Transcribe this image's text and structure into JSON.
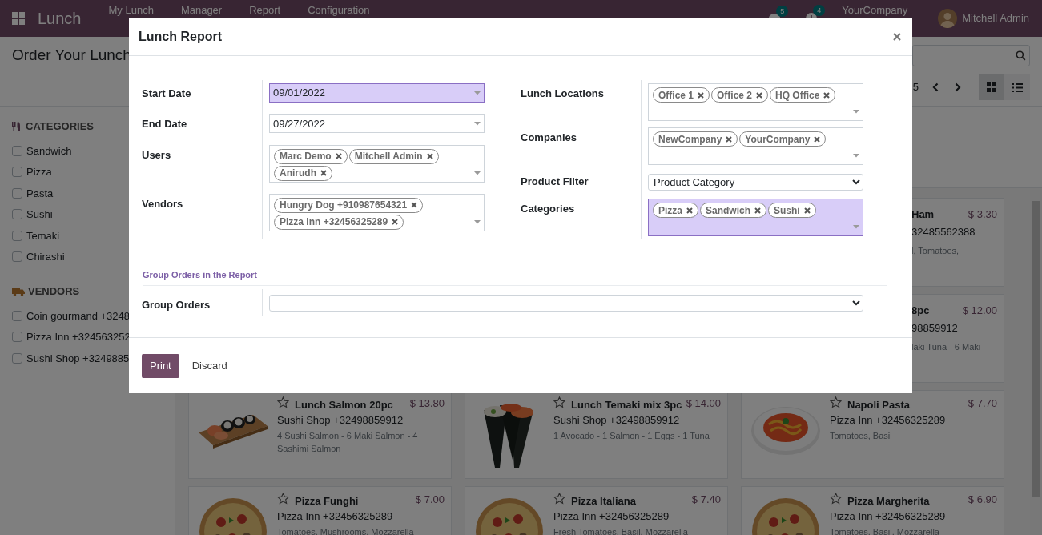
{
  "navbar": {
    "app_name": "Lunch",
    "menu": [
      "My Lunch",
      "Manager",
      "Report",
      "Configuration"
    ],
    "chat_count": "5",
    "activity_count": "4",
    "company": "YourCompany",
    "user": "Mitchell Admin"
  },
  "breadcrumb": "Order Your Lunch",
  "pager": "5",
  "views": [
    {
      "kind": "kanban",
      "selected": true
    },
    {
      "kind": "list",
      "selected": false
    }
  ],
  "sidebar": [
    {
      "kind": "categories",
      "title": "CATEGORIES",
      "items": [
        {
          "label": "Sandwich",
          "checked": false
        },
        {
          "label": "Pizza",
          "checked": false
        },
        {
          "label": "Pasta",
          "checked": false
        },
        {
          "label": "Sushi",
          "checked": false
        },
        {
          "label": "Temaki",
          "checked": false
        },
        {
          "label": "Chirashi",
          "checked": false
        }
      ]
    },
    {
      "kind": "vendors",
      "title": "VENDORS",
      "items": [
        {
          "label": "Coin gourmand +3248",
          "checked": false
        },
        {
          "label": "Pizza Inn +324563252",
          "checked": false
        },
        {
          "label": "Sushi Shop +3249885",
          "checked": false
        }
      ]
    }
  ],
  "cards": [
    {
      "kind": "clipped",
      "name": "Ham",
      "price": "$ 3.30",
      "vendor": "32485562388",
      "description": "l, Tomatoes,"
    },
    {
      "kind": "clipped",
      "name": "8pc",
      "price": "$ 12.00",
      "vendor": "98859912",
      "description": "laki Tuna - 6 Maki"
    },
    {
      "kind": "full",
      "name": "Lunch Salmon 20pc",
      "price": "$ 13.80",
      "vendor": "Sushi Shop +32498859912",
      "description": "4 Sushi Salmon - 6 Maki Salmon - 4 Sashimi Salmon",
      "favorite": false
    },
    {
      "kind": "full",
      "name": "Lunch Temaki mix 3pc",
      "price": "$ 14.00",
      "vendor": "Sushi Shop +32498859912",
      "description": "1 Avocado - 1 Salmon - 1 Eggs - 1 Tuna",
      "favorite": false
    },
    {
      "kind": "full",
      "name": "Napoli Pasta",
      "price": "$ 7.70",
      "vendor": "Pizza Inn +32456325289",
      "description": "Tomatoes, Basil",
      "favorite": false
    },
    {
      "kind": "full",
      "name": "Pizza Funghi",
      "price": "$ 7.00",
      "vendor": "Pizza Inn +32456325289",
      "description": "Tomatoes, Mushrooms, Mozzarella",
      "favorite": false
    },
    {
      "kind": "full",
      "name": "Pizza Italiana",
      "price": "$ 7.40",
      "vendor": "Pizza Inn +32456325289",
      "description": "Fresh Tomatoes, Basil, Mozzarella",
      "favorite": false
    },
    {
      "kind": "full",
      "name": "Pizza Margherita",
      "price": "$ 6.90",
      "vendor": "Pizza Inn +32456325289",
      "description": "Tomatoes, Basil, Mozzarella",
      "favorite": false
    }
  ],
  "dialog": {
    "title": "Lunch Report",
    "left_fields": [
      {
        "label": "Start Date",
        "kind": "date",
        "value": "09/01/2022",
        "required": true
      },
      {
        "label": "End Date",
        "kind": "date",
        "value": "09/27/2022",
        "required": false
      },
      {
        "label": "Users",
        "kind": "tags",
        "tags": [
          "Marc Demo",
          "Mitchell Admin",
          "Anirudh"
        ],
        "required": false
      },
      {
        "label": "Vendors",
        "kind": "tags",
        "tags": [
          "Hungry Dog +910987654321",
          "Pizza Inn +32456325289"
        ],
        "required": false
      }
    ],
    "right_fields": [
      {
        "label": "Lunch Locations",
        "kind": "tags",
        "tags": [
          "Office 1",
          "Office 2",
          "HQ Office"
        ],
        "required": false
      },
      {
        "label": "Companies",
        "kind": "tags",
        "tags": [
          "NewCompany",
          "YourCompany"
        ],
        "required": false
      },
      {
        "label": "Product Filter",
        "kind": "select",
        "value": "Product Category",
        "required": false
      },
      {
        "label": "Categories",
        "kind": "tags",
        "tags": [
          "Pizza",
          "Sandwich",
          "Sushi"
        ],
        "required": true
      }
    ],
    "group_heading": "Group Orders in the Report",
    "group_field": {
      "label": "Group Orders",
      "kind": "select",
      "required": false
    },
    "buttons": [
      {
        "label": "Print",
        "kind": "primary"
      },
      {
        "label": "Discard",
        "kind": "link"
      }
    ]
  }
}
